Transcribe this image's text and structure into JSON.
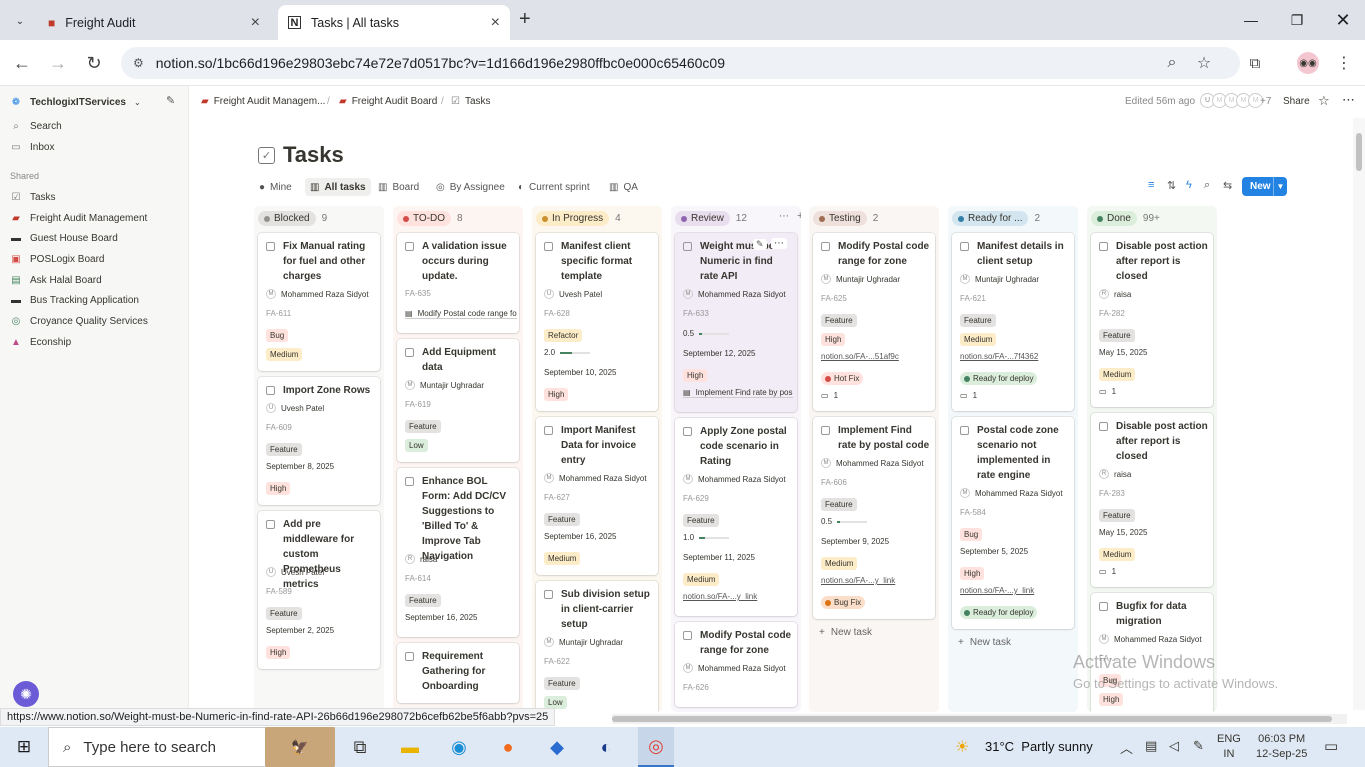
{
  "browser": {
    "tabs": [
      {
        "title": "Freight Audit"
      },
      {
        "title": "Tasks | All tasks"
      }
    ],
    "url": "notion.so/1bc66d196e29803ebc74e72e7d0517bc?v=1d166d196e2980ffbc0e000c65460c09"
  },
  "sidebar": {
    "workspace": "TechlogixITServices",
    "search": "Search",
    "inbox": "Inbox",
    "shared_label": "Shared",
    "items": [
      {
        "label": "Tasks"
      },
      {
        "label": "Freight Audit Management"
      },
      {
        "label": "Guest House Board"
      },
      {
        "label": "POSLogix Board"
      },
      {
        "label": "Ask Halal Board"
      },
      {
        "label": "Bus Tracking Application"
      },
      {
        "label": "Croyance Quality Services"
      },
      {
        "label": "Econship"
      }
    ]
  },
  "topbar": {
    "crumbs": [
      "Freight Audit Managem...",
      "Freight Audit Board",
      "Tasks"
    ],
    "edited": "Edited 56m ago",
    "avatars": [
      "U",
      "M",
      "M",
      "M",
      "M"
    ],
    "more_count": "+7",
    "share": "Share"
  },
  "page": {
    "title": "Tasks",
    "views": [
      "Mine",
      "All tasks",
      "Board",
      "By Assignee",
      "Current sprint",
      "QA"
    ],
    "new_button": "New"
  },
  "columns": [
    {
      "name": "Blocked",
      "count": "9",
      "bg": "#f8f8f7",
      "pill": "#e3e2e0",
      "dot": "#91918e",
      "cards": [
        {
          "title": "Fix Manual rating for fuel and other charges",
          "assignee": "Mohammed Raza Sidyot",
          "id": "FA-611",
          "tags": [
            {
              "t": "Bug",
              "c": "#ffe2dd"
            },
            {
              "t": "Medium",
              "c": "#fdecc8"
            }
          ]
        },
        {
          "title": "Import Zone Rows",
          "assignee": "Uvesh Patel",
          "id": "FA-609",
          "tags": [
            {
              "t": "Feature",
              "c": "#e3e2e0"
            }
          ],
          "date": "September 8, 2025",
          "prio": {
            "t": "High",
            "c": "#ffe2dd"
          }
        },
        {
          "title": "Add pre middleware for custom Prometheus metrics",
          "assignee": "Uvesh Patel",
          "id": "FA-589",
          "tags": [
            {
              "t": "Feature",
              "c": "#e3e2e0"
            }
          ],
          "date": "September 2, 2025",
          "prio": {
            "t": "High",
            "c": "#ffe2dd"
          }
        }
      ]
    },
    {
      "name": "TO-DO",
      "count": "8",
      "bg": "#fdf5f2",
      "pill": "#ffe2dd",
      "dot": "#d44c47",
      "cards": [
        {
          "title": "A validation issue occurs during update.",
          "id": "FA-635",
          "relation": "Modify Postal code range fo"
        },
        {
          "title": "Add Equipment data",
          "assignee": "Muntajir Ughradar",
          "id": "FA-619",
          "tags": [
            {
              "t": "Feature",
              "c": "#e3e2e0"
            },
            {
              "t": "Low",
              "c": "#dbeddb"
            }
          ]
        },
        {
          "title": "Enhance BOL Form: Add DC/CV Suggestions to 'Billed To' & Improve Tab Navigation",
          "assignee": "raisa",
          "id": "FA-614",
          "tags": [
            {
              "t": "Feature",
              "c": "#e3e2e0"
            }
          ],
          "date": "September 16, 2025"
        },
        {
          "title": "Requirement Gathering for Onboarding"
        }
      ]
    },
    {
      "name": "In Progress",
      "count": "4",
      "bg": "#fcf8f0",
      "pill": "#fdecc8",
      "dot": "#cb912f",
      "cards": [
        {
          "title": "Manifest client specific format template",
          "assignee": "Uvesh Patel",
          "id": "FA-628",
          "tags": [
            {
              "t": "Refactor",
              "c": "#fdecc8"
            }
          ],
          "progress": "2.0",
          "progress_fill": 0.4,
          "date": "September 10, 2025",
          "prio": {
            "t": "High",
            "c": "#ffe2dd"
          }
        },
        {
          "title": "Import Manifest Data for invoice entry",
          "assignee": "Mohammed Raza Sidyot",
          "id": "FA-627",
          "tags": [
            {
              "t": "Feature",
              "c": "#e3e2e0"
            }
          ],
          "date": "September 16, 2025",
          "prio": {
            "t": "Medium",
            "c": "#fdecc8"
          }
        },
        {
          "title": "Sub division setup in client-carrier setup",
          "assignee": "Muntajir Ughradar",
          "id": "FA-622",
          "tags": [
            {
              "t": "Feature",
              "c": "#e3e2e0"
            }
          ],
          "prio": {
            "t": "Low",
            "c": "#dbeddb"
          }
        }
      ]
    },
    {
      "name": "Review",
      "count": "12",
      "bg": "#f8f5fb",
      "pill": "#e8deee",
      "dot": "#9065b0",
      "cards": [
        {
          "title": "Weight must be Numeric in find rate API",
          "assignee": "Mohammed Raza Sidyot",
          "id": "FA-633",
          "progress": "0.5",
          "progress_fill": 0.1,
          "date": "September 12, 2025",
          "prio": {
            "t": "High",
            "c": "#ffe2dd"
          },
          "relation": "Implement Find rate by pos",
          "hover": true
        },
        {
          "title": "Apply Zone postal code scenario in Rating",
          "assignee": "Mohammed Raza Sidyot",
          "id": "FA-629",
          "tags": [
            {
              "t": "Feature",
              "c": "#e3e2e0"
            }
          ],
          "progress": "1.0",
          "progress_fill": 0.2,
          "date": "September 11, 2025",
          "prio": {
            "t": "Medium",
            "c": "#fdecc8"
          },
          "link": "notion.so/FA-...y_link"
        },
        {
          "title": "Modify Postal code range for zone",
          "assignee": "Mohammed Raza Sidyot",
          "id": "FA-626"
        }
      ]
    },
    {
      "name": "Testing",
      "count": "2",
      "bg": "#faf6f3",
      "pill": "#eee0da",
      "dot": "#9f6b53",
      "cards": [
        {
          "title": "Modify Postal code range for zone",
          "assignee": "Muntajir Ughradar",
          "id": "FA-625",
          "tags": [
            {
              "t": "Feature",
              "c": "#e3e2e0"
            },
            {
              "t": "High",
              "c": "#ffe2dd"
            }
          ],
          "link": "notion.so/FA-...51af9c",
          "status": {
            "t": "Hot Fix",
            "c": "#ffe2dd",
            "d": "#d44c47"
          },
          "comments": "1"
        },
        {
          "title": "Implement Find rate by postal code",
          "assignee": "Mohammed Raza Sidyot",
          "id": "FA-606",
          "tags": [
            {
              "t": "Feature",
              "c": "#e3e2e0"
            }
          ],
          "progress": "0.5",
          "progress_fill": 0.1,
          "date": "September 9, 2025",
          "prio": {
            "t": "Medium",
            "c": "#fdecc8"
          },
          "link": "notion.so/FA-...y_link",
          "status": {
            "t": "Bug Fix",
            "c": "#fadec9",
            "d": "#d9730d"
          }
        }
      ],
      "new_task": "New task"
    },
    {
      "name": "Ready for ...",
      "count": "2",
      "bg": "#f3f8fb",
      "pill": "#d3e5ef",
      "dot": "#337ea9",
      "cards": [
        {
          "title": "Manifest details in client setup",
          "assignee": "Muntajir Ughradar",
          "id": "FA-621",
          "tags": [
            {
              "t": "Feature",
              "c": "#e3e2e0"
            },
            {
              "t": "Medium",
              "c": "#fdecc8"
            }
          ],
          "link": "notion.so/FA-...7f4362",
          "status": {
            "t": "Ready for deploy",
            "c": "#dbeddb",
            "d": "#448361"
          },
          "comments": "1"
        },
        {
          "title": "Postal code zone scenario not implemented in rate engine",
          "assignee": "Mohammed Raza Sidyot",
          "id": "FA-584",
          "tags": [
            {
              "t": "Bug",
              "c": "#ffe2dd"
            }
          ],
          "date": "September 5, 2025",
          "prio": {
            "t": "High",
            "c": "#ffe2dd"
          },
          "link": "notion.so/FA-...y_link",
          "status": {
            "t": "Ready for deploy",
            "c": "#dbeddb",
            "d": "#448361"
          }
        }
      ],
      "new_task": "New task"
    },
    {
      "name": "Done",
      "count": "99+",
      "bg": "#f4f8f3",
      "pill": "#dbeddb",
      "dot": "#448361",
      "cards": [
        {
          "title": "Disable post action after report is closed",
          "assignee": "raisa",
          "id": "FA-282",
          "tags": [
            {
              "t": "Feature",
              "c": "#e3e2e0"
            }
          ],
          "date": "May 15, 2025",
          "prio": {
            "t": "Medium",
            "c": "#fdecc8"
          },
          "comments": "1"
        },
        {
          "title": "Disable post action after report is closed",
          "assignee": "raisa",
          "id": "FA-283",
          "tags": [
            {
              "t": "Feature",
              "c": "#e3e2e0"
            }
          ],
          "date": "May 15, 2025",
          "prio": {
            "t": "Medium",
            "c": "#fdecc8"
          },
          "comments": "1"
        },
        {
          "title": "Bugfix for data migration",
          "assignee": "Mohammed Raza Sidyot",
          "id": "FA-...",
          "tags": [
            {
              "t": "Bug",
              "c": "#ffe2dd"
            }
          ],
          "prio": {
            "t": "High",
            "c": "#ffe2dd"
          }
        }
      ]
    }
  ],
  "status_url": "https://www.notion.so/Weight-must-be-Numeric-in-find-rate-API-26b66d196e298072b6cefb62be5f6abb?pvs=25",
  "watermark": {
    "line1": "Activate Windows",
    "line2": "Go to Settings to activate Windows."
  },
  "taskbar": {
    "search_placeholder": "Type here to search",
    "weather": "31°C  Partly sunny",
    "lang1": "ENG",
    "lang2": "IN",
    "time": "06:03 PM",
    "date": "12-Sep-25"
  }
}
